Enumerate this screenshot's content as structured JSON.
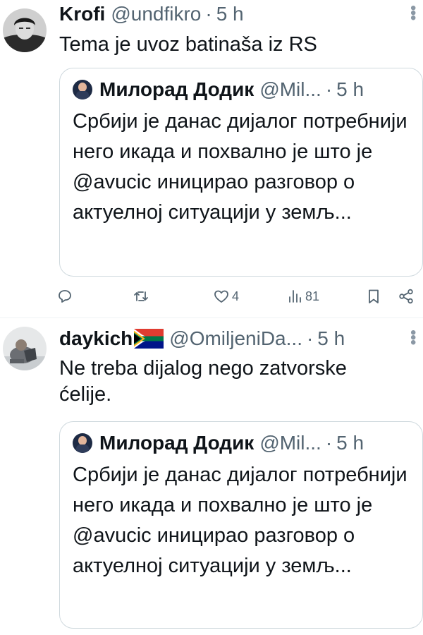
{
  "tweets": [
    {
      "author": {
        "name": "Krofi",
        "handle": "@undfikro",
        "separator": "·",
        "time": "5 h"
      },
      "text": "Tema je uvoz batinaša iz RS",
      "quote": {
        "name": "Милорад Додик",
        "handle": "@Mil...",
        "separator": "·",
        "time": "5 h",
        "text": "Србији је данас дијалог потребнији него икада и похвално је што је @avucic иницирао разговор о актуелној ситуацији у земљ..."
      },
      "stats": {
        "replies": "",
        "retweets": "",
        "likes": "4",
        "views": "81"
      }
    },
    {
      "author": {
        "name": "daykich",
        "handle": "@OmiljeniDa...",
        "separator": "·",
        "time": "5 h",
        "flag": "south-africa-flag"
      },
      "text": "Ne treba dijalog nego zatvorske ćelije.",
      "quote": {
        "name": "Милорад Додик",
        "handle": "@Mil...",
        "separator": "·",
        "time": "5 h",
        "text": "Србији је данас дијалог потребнији него икада и похвално је што је @avucic иницирао разговор о актуелној ситуацији у земљ..."
      }
    }
  ],
  "icons": {
    "reply": "reply-icon",
    "retweet": "retweet-icon",
    "like": "heart-icon",
    "views": "views-icon",
    "bookmark": "bookmark-icon",
    "share": "share-icon",
    "more": "more-vertical-icon"
  },
  "colors": {
    "text": "#0f1419",
    "secondary": "#536471",
    "border": "#cfd9de"
  }
}
